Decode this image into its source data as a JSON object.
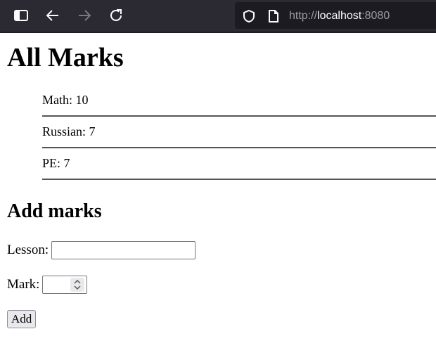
{
  "browser": {
    "icons": [
      "sidebar-icon",
      "back-arrow-icon",
      "forward-arrow-icon",
      "reload-icon",
      "shield-icon",
      "page-icon"
    ],
    "url": {
      "protocol": "http://",
      "host": "localhost",
      "port": ":8080"
    }
  },
  "page": {
    "title": "All Marks",
    "marks": [
      {
        "text": "Math: 10"
      },
      {
        "text": "Russian: 7"
      },
      {
        "text": "PE: 7"
      }
    ],
    "form": {
      "heading": "Add marks",
      "lesson_label": "Lesson:",
      "lesson_value": "",
      "mark_label": "Mark:",
      "mark_value": "",
      "add_label": "Add"
    }
  }
}
